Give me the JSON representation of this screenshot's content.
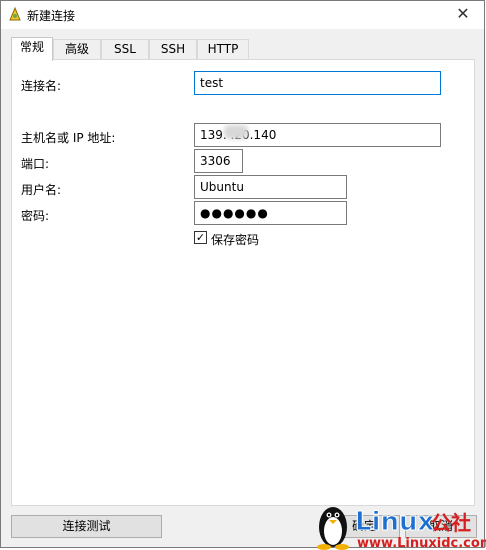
{
  "window": {
    "title": "新建连接"
  },
  "tabs": [
    {
      "label": "常规"
    },
    {
      "label": "高级"
    },
    {
      "label": "SSL"
    },
    {
      "label": "SSH"
    },
    {
      "label": "HTTP"
    }
  ],
  "form": {
    "connection_name": {
      "label": "连接名:",
      "value": "test"
    },
    "host": {
      "label": "主机名或 IP 地址:",
      "value": "139.   .20.140"
    },
    "port": {
      "label": "端口:",
      "value": "3306"
    },
    "username": {
      "label": "用户名:",
      "value": "Ubuntu"
    },
    "password": {
      "label": "密码:",
      "value": "●●●●●●"
    },
    "save_password": {
      "label": "保存密码",
      "checked": true
    }
  },
  "buttons": {
    "test_connection": "连接测试",
    "ok": "确定",
    "cancel": "取消"
  },
  "watermark": {
    "brand": "Linux公社",
    "url": "www.Linuxidc.com"
  }
}
